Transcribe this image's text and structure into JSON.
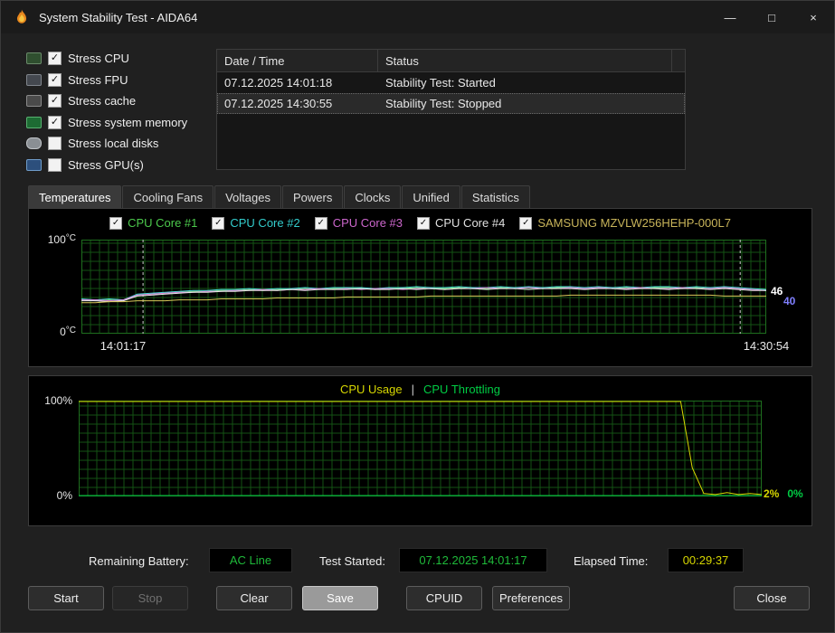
{
  "window": {
    "title": "System Stability Test - AIDA64",
    "minimize": "—",
    "maximize": "□",
    "close": "×"
  },
  "stress_options": [
    {
      "label": "Stress CPU",
      "checked": true,
      "icon": "cpu-icon"
    },
    {
      "label": "Stress FPU",
      "checked": true,
      "icon": "fpu-icon"
    },
    {
      "label": "Stress cache",
      "checked": true,
      "icon": "cache-icon"
    },
    {
      "label": "Stress system memory",
      "checked": true,
      "icon": "memory-icon"
    },
    {
      "label": "Stress local disks",
      "checked": false,
      "icon": "disk-icon"
    },
    {
      "label": "Stress GPU(s)",
      "checked": false,
      "icon": "gpu-icon"
    }
  ],
  "log": {
    "columns": [
      "Date / Time",
      "Status"
    ],
    "rows": [
      {
        "datetime": "07.12.2025 14:01:18",
        "status": "Stability Test: Started",
        "selected": false
      },
      {
        "datetime": "07.12.2025 14:30:55",
        "status": "Stability Test: Stopped",
        "selected": true
      }
    ]
  },
  "tabs": [
    {
      "label": "Temperatures",
      "active": true
    },
    {
      "label": "Cooling Fans",
      "active": false
    },
    {
      "label": "Voltages",
      "active": false
    },
    {
      "label": "Powers",
      "active": false
    },
    {
      "label": "Clocks",
      "active": false
    },
    {
      "label": "Unified",
      "active": false
    },
    {
      "label": "Statistics",
      "active": false
    }
  ],
  "status_bar": {
    "battery_label": "Remaining Battery:",
    "battery_value": "AC Line",
    "battery_color": "#1fba3a",
    "started_label": "Test Started:",
    "started_value": "07.12.2025 14:01:17",
    "started_color": "#1fba3a",
    "elapsed_label": "Elapsed Time:",
    "elapsed_value": "00:29:37",
    "elapsed_color": "#d6d600"
  },
  "buttons": [
    {
      "name": "start",
      "label": "Start",
      "disabled": false
    },
    {
      "name": "stop",
      "label": "Stop",
      "disabled": true
    },
    {
      "name": "clear",
      "label": "Clear",
      "disabled": false
    },
    {
      "name": "save",
      "label": "Save",
      "disabled": false
    },
    {
      "name": "cpuid",
      "label": "CPUID",
      "disabled": false
    },
    {
      "name": "preferences",
      "label": "Preferences",
      "disabled": false
    },
    {
      "name": "close-bottom",
      "label": "Close",
      "disabled": false
    }
  ],
  "chart_data": [
    {
      "type": "line",
      "title": "Temperatures",
      "ylabel": "°C",
      "ylim": [
        0,
        100
      ],
      "y_ticks": [
        "100",
        "0"
      ],
      "x_ticks": [
        "14:01:17",
        "14:30:54"
      ],
      "grid": true,
      "legend_position": "top",
      "markers": [
        0.09,
        0.962
      ],
      "legend": [
        {
          "label": "CPU Core #1",
          "color": "#4cc94c",
          "checked": true
        },
        {
          "label": "CPU Core #2",
          "color": "#33cccc",
          "checked": true
        },
        {
          "label": "CPU Core #3",
          "color": "#cc66cc",
          "checked": true
        },
        {
          "label": "CPU Core #4",
          "color": "#e0e0e0",
          "checked": true
        },
        {
          "label": "SAMSUNG MZVLW256HEHP-000L7",
          "color": "#c8b45a",
          "checked": true
        }
      ],
      "current_values": [
        {
          "text": "46",
          "color": "#ffffff"
        },
        {
          "text": "40",
          "color": "#8080ff"
        }
      ],
      "series": [
        {
          "name": "CPU Core #1",
          "color": "#7ce87c",
          "values": [
            36,
            35,
            36,
            35,
            41,
            42,
            43,
            44,
            45,
            45,
            46,
            46,
            47,
            46,
            47,
            47,
            48,
            47,
            48,
            48,
            48,
            47,
            48,
            48,
            49,
            48,
            48,
            49,
            48,
            48,
            49,
            48,
            49,
            48,
            49,
            49,
            48,
            49,
            48,
            49,
            48,
            49,
            49,
            48,
            49,
            48,
            49,
            48,
            47,
            46
          ]
        },
        {
          "name": "CPU Core #2",
          "color": "#4cd9d9",
          "values": [
            37,
            36,
            37,
            36,
            42,
            43,
            44,
            45,
            46,
            46,
            47,
            47,
            48,
            47,
            48,
            48,
            49,
            48,
            49,
            49,
            49,
            48,
            49,
            49,
            50,
            49,
            49,
            50,
            49,
            49,
            50,
            49,
            50,
            49,
            50,
            50,
            49,
            50,
            49,
            50,
            49,
            50,
            50,
            49,
            50,
            49,
            50,
            49,
            48,
            47
          ]
        },
        {
          "name": "CPU Core #3",
          "color": "#d97cd9",
          "values": [
            36,
            36,
            35,
            36,
            41,
            42,
            43,
            44,
            44,
            45,
            45,
            46,
            46,
            47,
            46,
            47,
            47,
            48,
            47,
            48,
            47,
            48,
            48,
            47,
            48,
            48,
            47,
            48,
            48,
            49,
            48,
            48,
            49,
            48,
            48,
            49,
            48,
            49,
            48,
            48,
            49,
            48,
            48,
            49,
            48,
            48,
            49,
            48,
            47,
            46
          ]
        },
        {
          "name": "CPU Core #4",
          "color": "#e8e8e8",
          "values": [
            35,
            35,
            34,
            35,
            40,
            41,
            42,
            43,
            44,
            44,
            45,
            45,
            46,
            46,
            46,
            47,
            46,
            47,
            47,
            47,
            48,
            47,
            47,
            48,
            47,
            48,
            47,
            48,
            48,
            47,
            48,
            48,
            47,
            48,
            48,
            48,
            47,
            48,
            48,
            47,
            48,
            48,
            47,
            48,
            48,
            47,
            48,
            47,
            46,
            46
          ]
        },
        {
          "name": "SAMSUNG MZVLW256HEHP-000L7",
          "color": "#d9c85a",
          "values": [
            33,
            33,
            34,
            34,
            35,
            35,
            35,
            36,
            36,
            36,
            37,
            37,
            37,
            37,
            38,
            38,
            38,
            38,
            38,
            39,
            39,
            39,
            39,
            39,
            39,
            40,
            40,
            40,
            40,
            40,
            40,
            40,
            40,
            40,
            40,
            41,
            41,
            41,
            41,
            41,
            41,
            41,
            41,
            41,
            41,
            41,
            40,
            40,
            40,
            40
          ]
        }
      ]
    },
    {
      "type": "line",
      "title_parts": [
        {
          "text": "CPU Usage",
          "color": "#d6d600"
        },
        {
          "text": "|",
          "color": "#cccccc"
        },
        {
          "text": "CPU Throttling",
          "color": "#00cc44"
        }
      ],
      "ylim": [
        0,
        100
      ],
      "y_ticks": [
        "100%",
        "0%"
      ],
      "grid": true,
      "current_values": [
        {
          "text": "2%",
          "color": "#d6d600"
        },
        {
          "text": "0%",
          "color": "#00cc44"
        }
      ],
      "series": [
        {
          "name": "CPU Usage",
          "color": "#d9d900",
          "values": [
            100,
            100,
            100,
            100,
            100,
            100,
            100,
            100,
            100,
            100,
            100,
            100,
            100,
            100,
            100,
            100,
            100,
            100,
            100,
            100,
            100,
            100,
            100,
            100,
            100,
            100,
            100,
            100,
            100,
            100,
            100,
            100,
            100,
            100,
            100,
            100,
            100,
            100,
            100,
            100,
            100,
            100,
            100,
            100,
            100,
            100,
            100,
            100,
            100,
            100,
            100,
            100,
            100,
            30,
            3,
            2,
            4,
            2,
            3,
            2
          ]
        },
        {
          "name": "CPU Throttling",
          "color": "#00cc44",
          "values": [
            0,
            0
          ]
        }
      ]
    }
  ]
}
